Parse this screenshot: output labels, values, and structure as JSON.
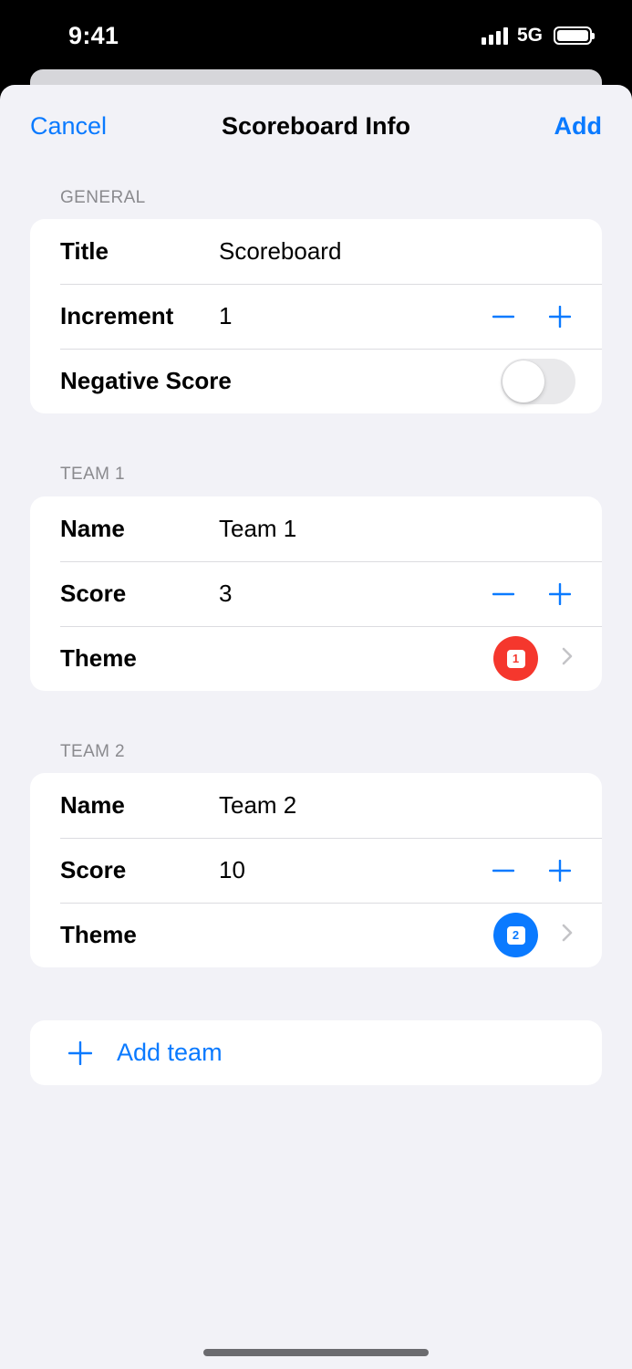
{
  "status_bar": {
    "time": "9:41",
    "network": "5G"
  },
  "nav": {
    "cancel_label": "Cancel",
    "title": "Scoreboard Info",
    "add_label": "Add"
  },
  "general": {
    "header": "GENERAL",
    "title_label": "Title",
    "title_value": "Scoreboard",
    "increment_label": "Increment",
    "increment_value": "1",
    "negative_label": "Negative Score",
    "negative_enabled": false
  },
  "teams": [
    {
      "header": "TEAM 1",
      "name_label": "Name",
      "name_value": "Team 1",
      "score_label": "Score",
      "score_value": "3",
      "theme_label": "Theme",
      "theme_number": "1",
      "theme_color": "#f5372d"
    },
    {
      "header": "TEAM 2",
      "name_label": "Name",
      "name_value": "Team 2",
      "score_label": "Score",
      "score_value": "10",
      "theme_label": "Theme",
      "theme_number": "2",
      "theme_color": "#0a7aff"
    }
  ],
  "add_team": {
    "label": "Add team"
  },
  "colors": {
    "accent": "#0a7aff",
    "background": "#f2f2f7"
  },
  "icons": [
    "minus-icon",
    "plus-icon",
    "chevron-right-icon",
    "signal-icon",
    "battery-icon"
  ]
}
